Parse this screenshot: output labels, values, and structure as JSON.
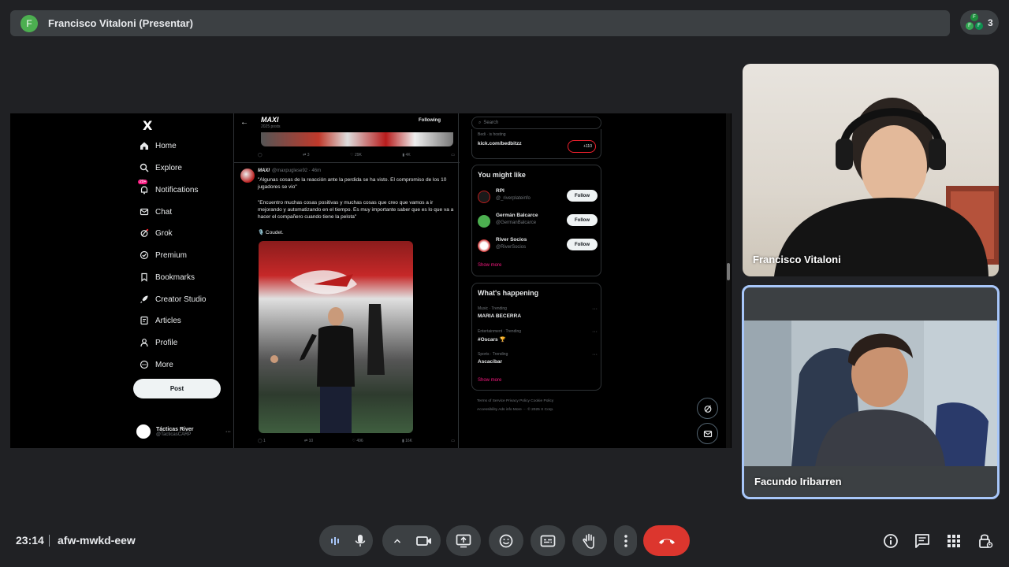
{
  "presenter": {
    "initial": "F",
    "name": "Francisco Vitaloni (Presentar)",
    "participant_count": "3",
    "mini_avatars": [
      "F",
      "F",
      "F"
    ]
  },
  "screen": {
    "sidebar": {
      "logo": "X",
      "nav": [
        {
          "label": "Home",
          "icon": "home-icon"
        },
        {
          "label": "Explore",
          "icon": "search-icon"
        },
        {
          "label": "Notifications",
          "icon": "bell-icon",
          "badge": "20+"
        },
        {
          "label": "Chat",
          "icon": "mail-icon"
        },
        {
          "label": "Grok",
          "icon": "grok-icon"
        },
        {
          "label": "Premium",
          "icon": "premium-icon"
        },
        {
          "label": "Bookmarks",
          "icon": "bookmark-icon"
        },
        {
          "label": "Creator Studio",
          "icon": "rocket-icon"
        },
        {
          "label": "Articles",
          "icon": "articles-icon"
        },
        {
          "label": "Profile",
          "icon": "person-icon"
        },
        {
          "label": "More",
          "icon": "more-icon"
        }
      ],
      "post_label": "Post",
      "account": {
        "name": "Tácticas River",
        "handle": "@TacticasCARP"
      }
    },
    "feed": {
      "back_glyph": "←",
      "title": "MAXI",
      "posts_count": "2025 posts",
      "following_label": "Following",
      "top_stats": {
        "replies": "",
        "reposts": "3",
        "likes": "29K",
        "views": "4K"
      },
      "tweet": {
        "author": "MAXI",
        "handle": "@maxpuglese92 · 46m",
        "paragraph1": "\"Algunas cosas de la reacción ante la perdida se ha visto. El compromiso de los 10 jugadores se vio\"",
        "paragraph2": "\"Encuentro muchas cosas positivas y muchas cosas que creo que vamos a ir mejorando y automatizando en el tiempo. Es muy importante saber que es lo que va a hacer el compañero cuando tiene la pelota\"",
        "attribution": "🎙️ Coudet.",
        "stats": {
          "replies": "1",
          "reposts": "10",
          "likes": "496",
          "views": "16K"
        }
      }
    },
    "right": {
      "search_placeholder": "Search",
      "kick_line": "Bedi · is hosting",
      "kick_link": "kick.com/bedbitzz",
      "kick_badge": "+110",
      "you_might_like": {
        "title": "You might like",
        "items": [
          {
            "name": "RPI",
            "handle": "@_riverplateinfo",
            "follow": "Follow"
          },
          {
            "name": "Germán Balcarce",
            "handle": "@GermanBalcarce",
            "follow": "Follow"
          },
          {
            "name": "River Socios",
            "handle": "@RiverSocios",
            "follow": "Follow"
          }
        ],
        "show_more": "Show more"
      },
      "whats_happening": {
        "title": "What's happening",
        "items": [
          {
            "category": "Music · Trending",
            "name": "MARIA BECERRA"
          },
          {
            "category": "Entertainment · Trending",
            "name": "#Oscars 🏆"
          },
          {
            "category": "Sports · Trending",
            "name": "Ascacibar"
          }
        ],
        "show_more": "Show more"
      },
      "footer_line1": "Terms of Service   Privacy Policy   Cookie Policy",
      "footer_line2": "Accessibility   Ads info   More ···   © 2025 X Corp."
    }
  },
  "tiles": {
    "francisco": "Francisco Vitaloni",
    "facundo": "Facundo Iribarren"
  },
  "meeting": {
    "time": "23:14",
    "code": "afw-mwkd-eew"
  },
  "colors": {
    "end_call": "#dc362e",
    "active_border": "#a8c7fa",
    "x_pink": "#f91880"
  }
}
